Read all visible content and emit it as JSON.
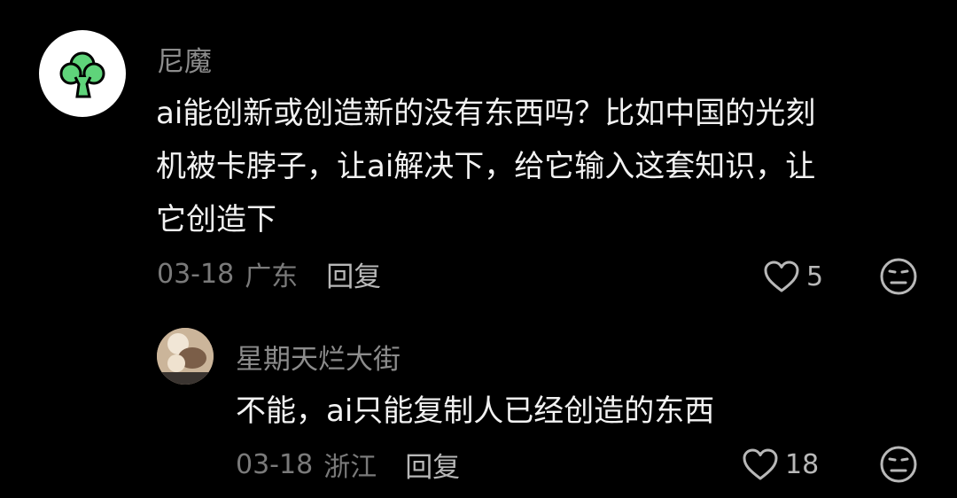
{
  "comments": [
    {
      "username": "尼魔",
      "avatar_icon": "broccoli-icon",
      "text_lines": [
        "ai能创新或创造新的没有东西吗？比如中国的光刻",
        "机被卡脖子，让ai解决下，给它输入这套知识，让",
        "它创造下"
      ],
      "date": "03-18",
      "region": "广东",
      "reply_label": "回复",
      "likes": "5"
    },
    {
      "username": "星期天烂大街",
      "avatar_icon": "photo-avatar",
      "text_lines": [
        "不能，ai只能复制人已经创造的东西"
      ],
      "date": "03-18",
      "region": "浙江",
      "reply_label": "回复",
      "likes": "18"
    }
  ],
  "icons": {
    "like": "heart-outline-icon",
    "emoji": "neutral-face-icon"
  },
  "colors": {
    "background": "#000000",
    "username": "#8c8c8c",
    "text": "#f2f2f2",
    "meta": "#7a7a7a",
    "broccoli": "#5fd47a"
  }
}
